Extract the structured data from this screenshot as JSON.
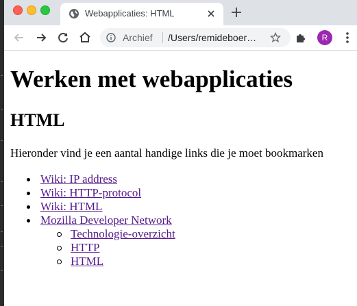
{
  "browser": {
    "tab": {
      "title": "Webapplicaties: HTML",
      "icon": "globe-icon"
    },
    "toolbar": {
      "omnibox": {
        "chip_label": "Archief",
        "url": "/Users/remideboer…"
      },
      "avatar_letter": "R",
      "avatar_color": "#9c27b0"
    }
  },
  "page": {
    "title": "Werken met webapplicaties",
    "section_title": "HTML",
    "intro": "Hieronder vind je een aantal handige links die je moet bookmarken",
    "links": [
      {
        "label": "Wiki: IP address"
      },
      {
        "label": "Wiki: HTTP-protocol"
      },
      {
        "label": "Wiki: HTML"
      },
      {
        "label": "Mozilla Developer Network",
        "children": [
          {
            "label": "Technologie-overzicht"
          },
          {
            "label": "HTTP"
          },
          {
            "label": "HTML"
          }
        ]
      }
    ],
    "link_color": "#551a8b"
  }
}
